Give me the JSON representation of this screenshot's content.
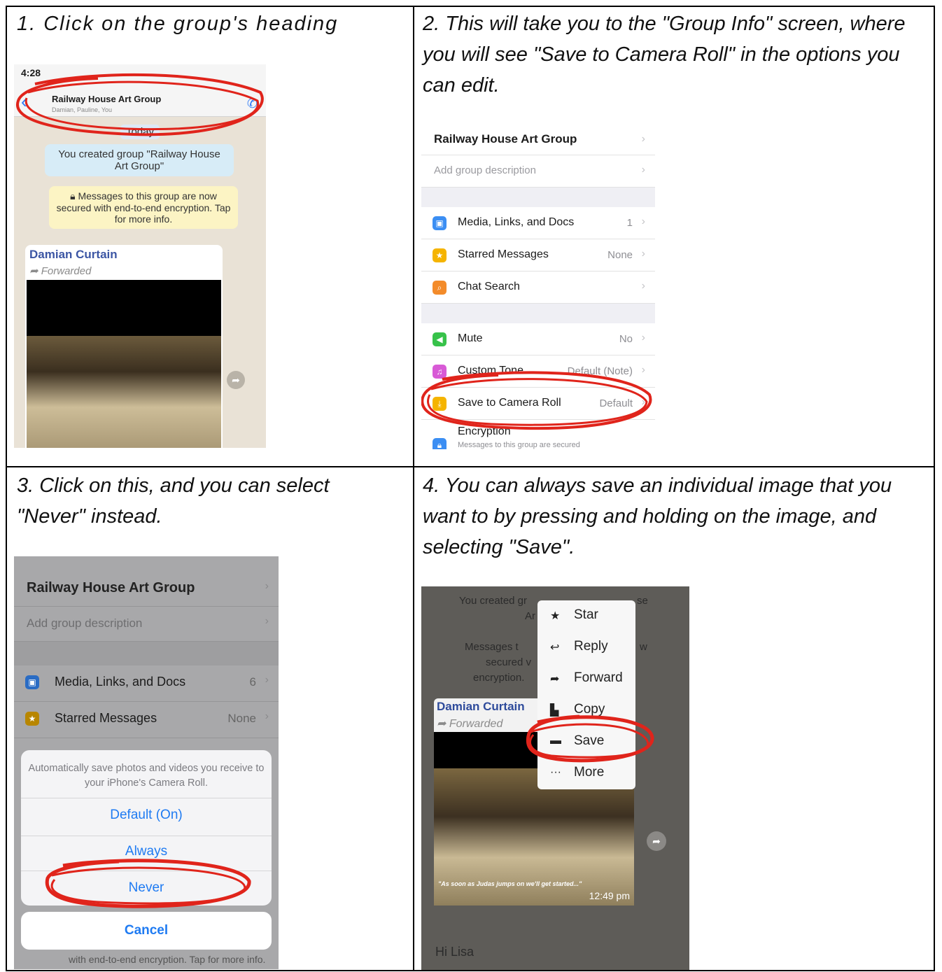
{
  "steps": [
    {
      "caption": "1. Click on the group's heading"
    },
    {
      "caption": "2. This will take you to the \"Group Info\" screen, where you will see \"Save to Camera Roll\" in the options you can edit."
    },
    {
      "caption": "3. Click on this, and you can select \"Never\" instead."
    },
    {
      "caption": "4. You can always save an individual image that you want to by pressing and holding on the image, and selecting \"Save\"."
    }
  ],
  "screen1": {
    "time": "4:28",
    "group_name": "Railway House Art Group",
    "members": "Damian, Pauline, You",
    "date_chip": "Today",
    "system_message": "You created group \"Railway House Art Group\"",
    "encryption_message": "Messages to this group are now secured with end-to-end encryption. Tap for more info.",
    "sender": "Damian Curtain",
    "forwarded": "Forwarded"
  },
  "screen2": {
    "group_name": "Railway House Art Group",
    "description_placeholder": "Add group description",
    "rows": [
      {
        "label": "Media, Links, and Docs",
        "value": "1",
        "icon": "photo-icon",
        "color": "#3b8ef3"
      },
      {
        "label": "Starred Messages",
        "value": "None",
        "icon": "star-icon",
        "color": "#f5b400"
      },
      {
        "label": "Chat Search",
        "value": "",
        "icon": "search-icon",
        "color": "#f38b2a"
      },
      {
        "label": "Mute",
        "value": "No",
        "icon": "speaker-icon",
        "color": "#37c24a"
      },
      {
        "label": "Custom Tone",
        "value": "Default (Note)",
        "icon": "music-icon",
        "color": "#d85ad6"
      },
      {
        "label": "Save to Camera Roll",
        "value": "Default",
        "icon": "save-icon",
        "color": "#f5b400"
      }
    ],
    "encryption_label": "Encryption",
    "encryption_sub": "Messages to this group are secured"
  },
  "screen3": {
    "group_name": "Railway House Art Group",
    "description_placeholder": "Add group description",
    "rows": [
      {
        "label": "Media, Links, and Docs",
        "value": "6",
        "icon": "photo-icon",
        "color": "#3b8ef3"
      },
      {
        "label": "Starred Messages",
        "value": "None",
        "icon": "star-icon",
        "color": "#f5b400"
      }
    ],
    "sheet_text": "Automatically save photos and videos you receive to your iPhone's Camera Roll.",
    "options": [
      "Default (On)",
      "Always",
      "Never"
    ],
    "cancel": "Cancel",
    "footer": "with end-to-end encryption. Tap for more info."
  },
  "screen4": {
    "bg_text_1": "You created gr",
    "bg_text_2": "se",
    "bg_text_3": "Ar",
    "bg_text_4": "Messages t",
    "bg_text_5": "secured v",
    "bg_text_6": "encryption.",
    "bg_text_7": "w",
    "sender": "Damian Curtain",
    "forwarded": "Forwarded",
    "caption": "\"As soon as Judas jumps on we'll get started...\"",
    "timestamp": "12:49 pm",
    "next_message": "Hi Lisa",
    "menu": [
      {
        "label": "Star",
        "icon": "star-icon",
        "glyph": "★"
      },
      {
        "label": "Reply",
        "icon": "reply-icon",
        "glyph": "↩"
      },
      {
        "label": "Forward",
        "icon": "forward-icon",
        "glyph": "➦"
      },
      {
        "label": "Copy",
        "icon": "copy-icon",
        "glyph": "▙"
      },
      {
        "label": "Save",
        "icon": "folder-icon",
        "glyph": "▬"
      },
      {
        "label": "More",
        "icon": "more-icon",
        "glyph": "···"
      }
    ]
  },
  "colors": {
    "annotation": "#e0241b",
    "ios_blue": "#1f7bf2"
  }
}
